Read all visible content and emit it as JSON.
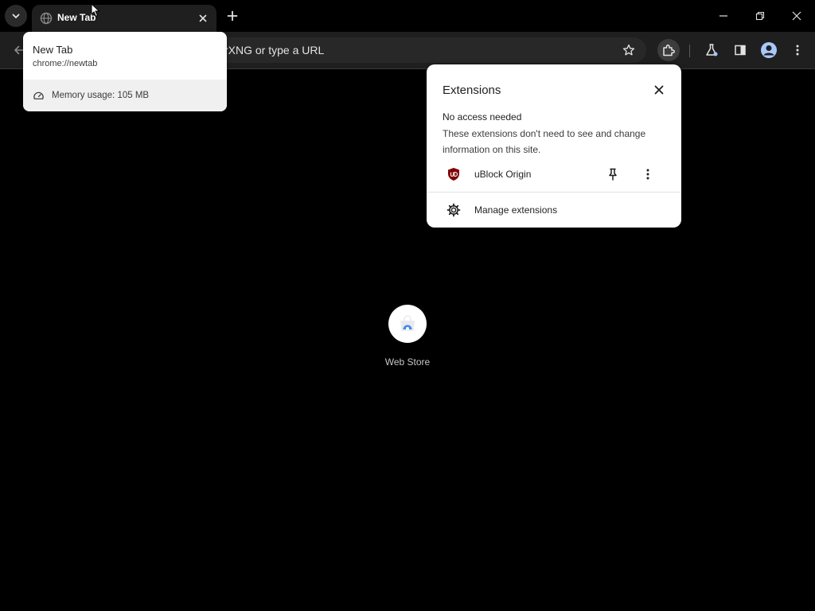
{
  "browser": {
    "tab": {
      "title": "New Tab"
    },
    "omnibox": {
      "text": "rXNG or type a URL"
    }
  },
  "hovercard": {
    "title": "New Tab",
    "url": "chrome://newtab",
    "memory": "Memory usage: 105 MB"
  },
  "extensions_popup": {
    "title": "Extensions",
    "section": "No access needed",
    "description": "These extensions don't need to see and change information on this site.",
    "items": [
      {
        "name": "uBlock Origin"
      }
    ],
    "manage_label": "Manage extensions"
  },
  "ntp": {
    "shortcuts": [
      {
        "label": "Web Store"
      }
    ]
  },
  "colors": {
    "background": "#000000",
    "toolbar": "#1f1f1f",
    "ublock_red": "#800000",
    "profile_blue": "#a8c7fa"
  }
}
